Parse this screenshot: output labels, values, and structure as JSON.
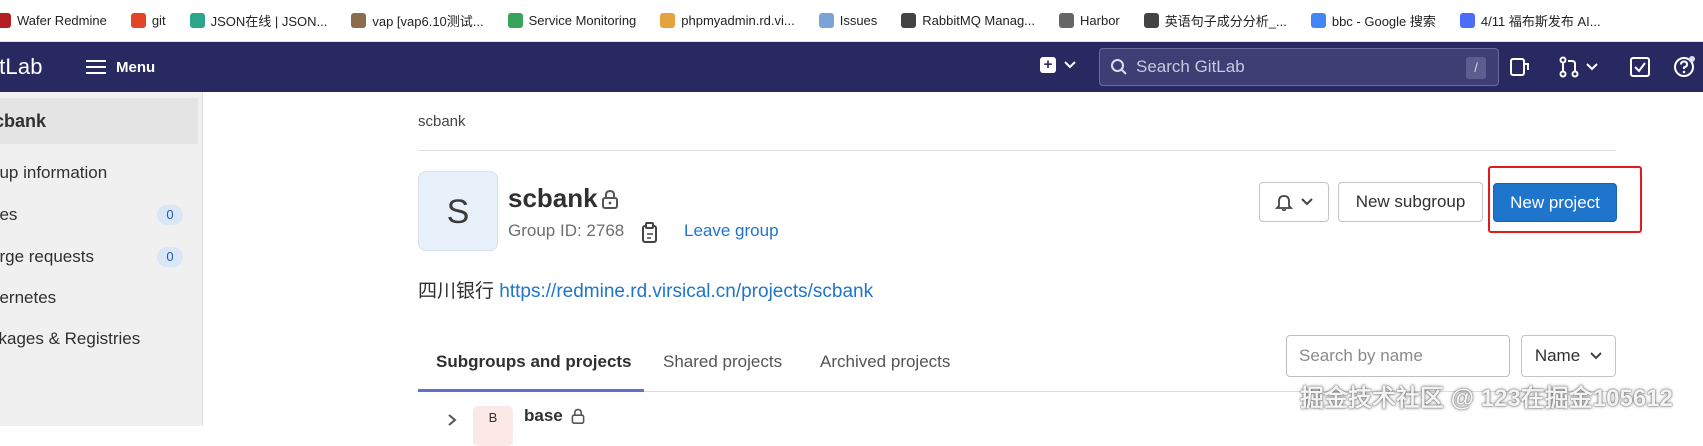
{
  "bookmarks": [
    {
      "label": "Wafer Redmine",
      "icon": "redmine-icon",
      "color": "#b32024"
    },
    {
      "label": "git",
      "icon": "gitlab-icon",
      "color": "#e24329"
    },
    {
      "label": "JSON在线 | JSON...",
      "icon": "json-icon",
      "color": "#2ca58d"
    },
    {
      "label": "vap [vap6.10测试...",
      "icon": "avatar-icon",
      "color": "#8a6d4b"
    },
    {
      "label": "Service Monitoring",
      "icon": "monitor-icon",
      "color": "#3aa35b"
    },
    {
      "label": "phpmyadmin.rd.vi...",
      "icon": "phpmyadmin-icon",
      "color": "#e6a23c"
    },
    {
      "label": "Issues",
      "icon": "issues-icon",
      "color": "#7aa3d6"
    },
    {
      "label": "RabbitMQ Manag...",
      "icon": "globe-icon",
      "color": "#444444"
    },
    {
      "label": "Harbor",
      "icon": "harbor-icon",
      "color": "#666666"
    },
    {
      "label": "英语句子成分分析_...",
      "icon": "globe-icon",
      "color": "#444444"
    },
    {
      "label": "bbc - Google 搜索",
      "icon": "google-icon",
      "color": "#4285f4"
    },
    {
      "label": "4/11 福布斯发布 AI...",
      "icon": "doc-icon",
      "color": "#4a6cf7"
    }
  ],
  "topnav": {
    "logo": "itLab",
    "menu_label": "Menu",
    "search_placeholder": "Search GitLab",
    "search_key": "/"
  },
  "sidebar": {
    "title": "cbank",
    "items": [
      {
        "label": "oup information",
        "badge": null
      },
      {
        "label": "ues",
        "badge": "0"
      },
      {
        "label": "erge requests",
        "badge": "0"
      },
      {
        "label": "bernetes",
        "badge": null
      },
      {
        "label": "ckages & Registries",
        "badge": null
      }
    ]
  },
  "main": {
    "breadcrumb": "scbank",
    "avatar_letter": "S",
    "group_name": "scbank",
    "group_id": "Group ID: 2768",
    "leave_label": "Leave group",
    "new_subgroup_label": "New subgroup",
    "new_project_label": "New project",
    "description_prefix": "四川银行",
    "description_link": "https://redmine.rd.virsical.cn/projects/scbank",
    "tabs": [
      "Subgroups and projects",
      "Shared projects",
      "Archived projects"
    ],
    "filter_placeholder": "Search by name",
    "sort_label": "Name",
    "first_row": {
      "avatar": "B",
      "name": "base"
    }
  },
  "colors": {
    "nav_bg": "#292961",
    "primary": "#1f75cb",
    "highlight": "#e11b1b"
  },
  "watermark": "掘金技术社区 @ 123在掘金105612"
}
